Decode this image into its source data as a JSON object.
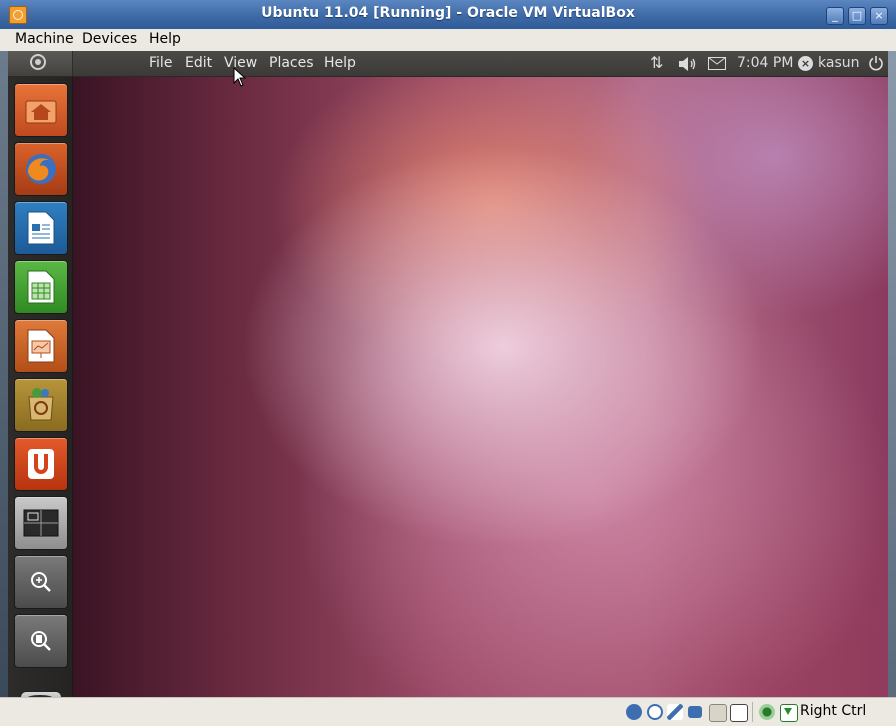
{
  "window": {
    "title": "Ubuntu 11.04 [Running] - Oracle VM VirtualBox",
    "controls": [
      "_",
      "□",
      "×"
    ]
  },
  "menubar": {
    "items": [
      "Machine",
      "Devices",
      "Help"
    ]
  },
  "guest_panel": {
    "menus": [
      "File",
      "Edit",
      "View",
      "Places",
      "Help"
    ],
    "time": "7:04 PM",
    "user": "kasun"
  },
  "launcher": {
    "items": [
      "home-folder",
      "firefox",
      "libreoffice-writer",
      "libreoffice-calc",
      "libreoffice-impress",
      "ubuntu-software-center",
      "ubuntu-one",
      "workspaces",
      "applications",
      "files-folders",
      "trash"
    ]
  },
  "statusbar": {
    "host_key": "Right Ctrl"
  },
  "colors": {
    "titlebar": "#3e6aa6",
    "panel": "#3f3e3b",
    "launcher": "#2a2826"
  }
}
